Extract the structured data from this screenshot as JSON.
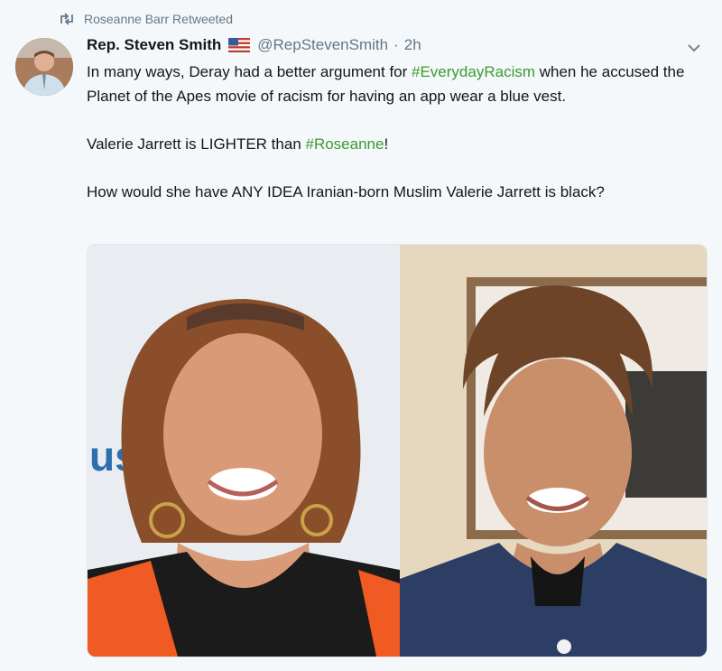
{
  "retweet": {
    "text": "Roseanne Barr Retweeted"
  },
  "author": {
    "name": "Rep. Steven Smith",
    "handle": "@RepStevenSmith",
    "separator": "·",
    "time": "2h"
  },
  "tweet": {
    "line1_a": "In many ways, Deray had a better argument for ",
    "hashtag1": "#EverydayRacism",
    "line1_b": " when he accused the Planet of the Apes movie of racism for having an app wear a blue vest.",
    "line2_a": "Valerie Jarrett is LIGHTER than ",
    "hashtag2": "#Roseanne",
    "line2_b": "!",
    "line3": "How would she have ANY IDEA Iranian-born Muslim Valerie Jarrett is black?"
  },
  "colors": {
    "hashtag": "#3b9a2f",
    "secondary_text": "#657786",
    "background": "#f5f8fa"
  },
  "icons": {
    "retweet": "retweet-icon",
    "flag": "us-flag-icon",
    "menu": "chevron-down-icon"
  }
}
